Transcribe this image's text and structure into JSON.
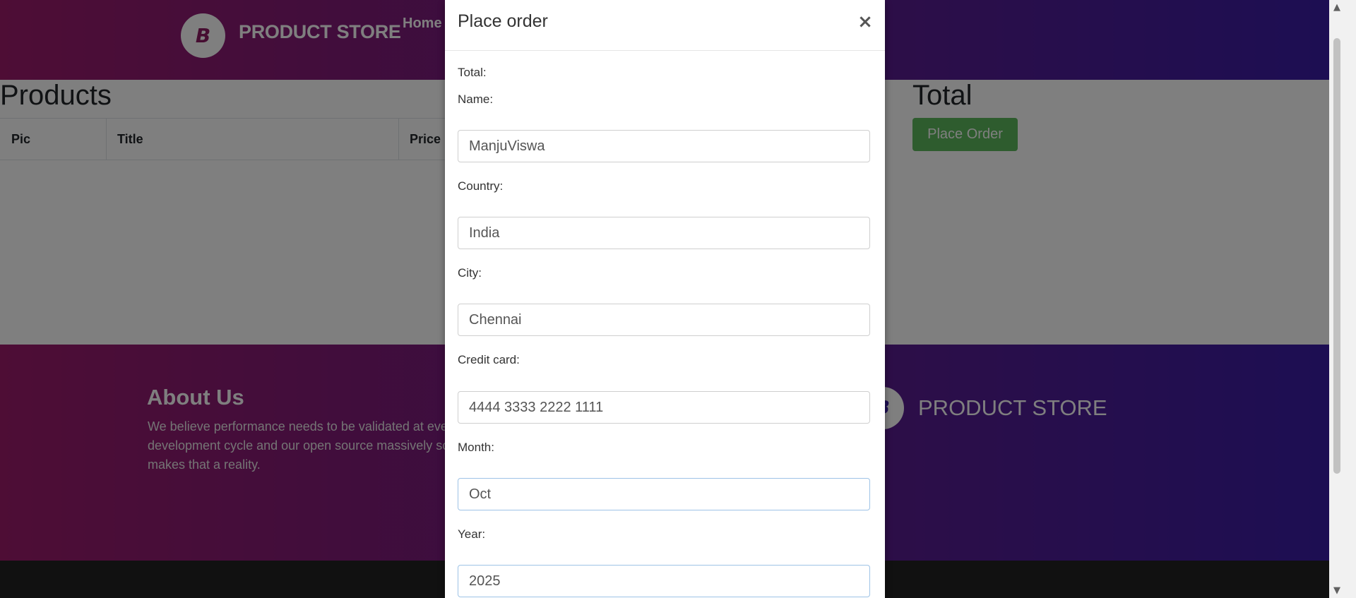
{
  "navbar": {
    "brand_name": "PRODUCT STORE",
    "logo_letter": "B",
    "home_label": "Home"
  },
  "cart": {
    "products_title": "Products",
    "columns": [
      "Pic",
      "Title",
      "Price"
    ],
    "total_title": "Total",
    "place_order_label": "Place Order"
  },
  "footer": {
    "about_title": "About Us",
    "about_text": "We believe performance needs to be validated at eve the software development cycle and our open source massively scalable platform makes that a reality.",
    "brand_name": "PRODUCT STORE",
    "logo_letter": "B"
  },
  "modal": {
    "title": "Place order",
    "close_glyph": "×",
    "total_label": "Total:",
    "name_label": "Name:",
    "name_value": "ManjuViswa",
    "country_label": "Country:",
    "country_value": "India",
    "city_label": "City:",
    "city_value": "Chennai",
    "card_label": "Credit card:",
    "card_value": "4444 3333 2222 1111",
    "month_label": "Month:",
    "month_value": "Oct",
    "year_label": "Year:",
    "year_value": "2025"
  },
  "colors": {
    "brand_gradient_start": "#9c1a6b",
    "brand_gradient_end": "#3a1ca6",
    "success": "#5cb85c"
  }
}
